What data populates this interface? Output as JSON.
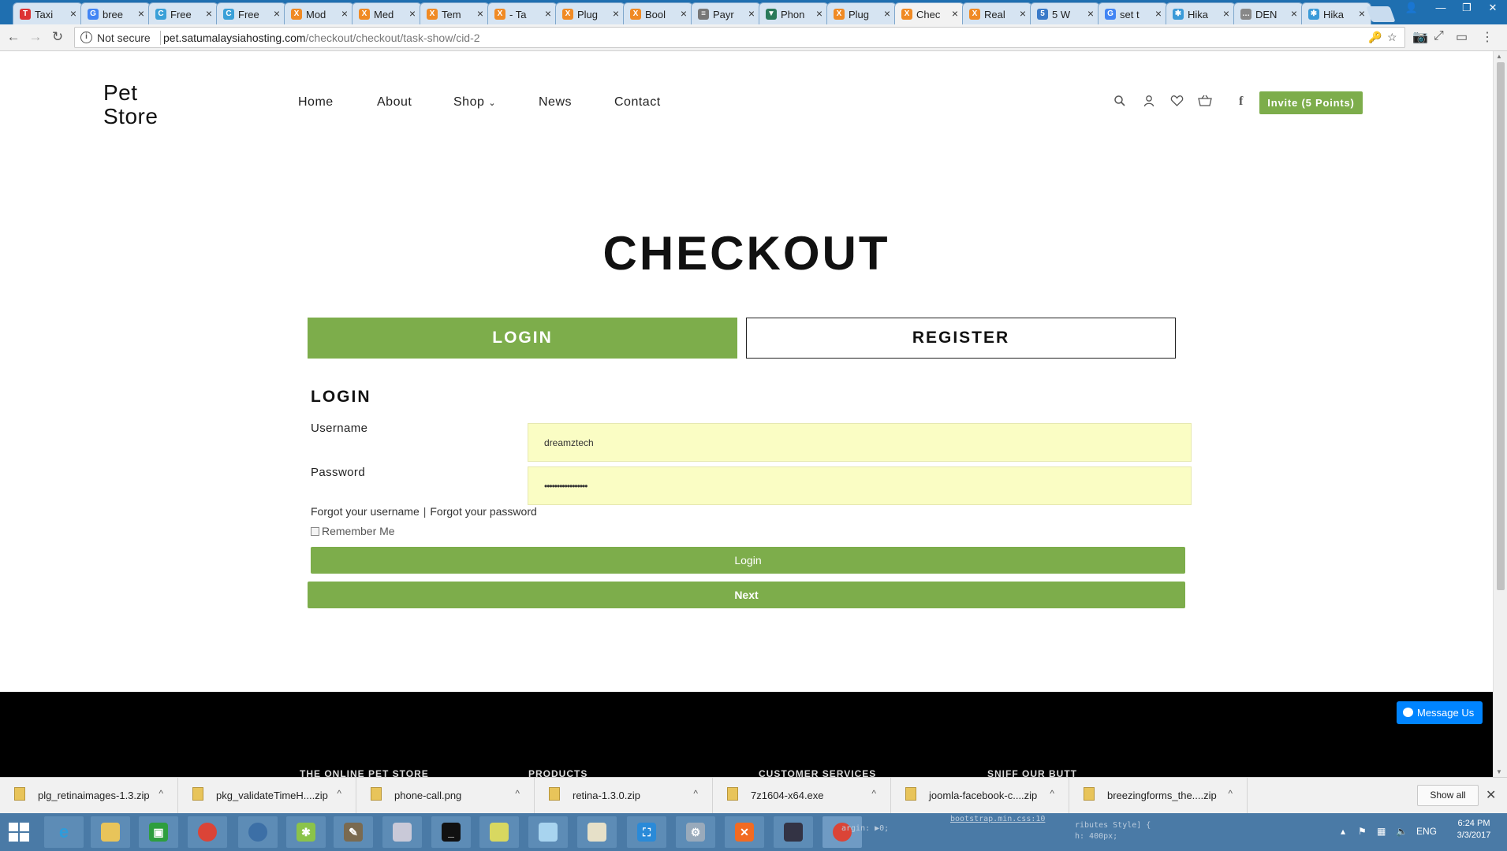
{
  "browser": {
    "tabs": [
      {
        "label": "Taxi",
        "fav": "T",
        "color": "#d33"
      },
      {
        "label": "bree",
        "fav": "G",
        "color": "#4285f4"
      },
      {
        "label": "Free",
        "fav": "C",
        "color": "#3aa0d8"
      },
      {
        "label": "Free",
        "fav": "C",
        "color": "#3aa0d8"
      },
      {
        "label": "Mod",
        "fav": "X",
        "color": "#f08a24"
      },
      {
        "label": "Med",
        "fav": "X",
        "color": "#f08a24"
      },
      {
        "label": "Tem",
        "fav": "X",
        "color": "#f08a24"
      },
      {
        "label": "- Ta",
        "fav": "X",
        "color": "#f08a24"
      },
      {
        "label": "Plug",
        "fav": "X",
        "color": "#f08a24"
      },
      {
        "label": "Bool",
        "fav": "X",
        "color": "#f08a24"
      },
      {
        "label": "Payr",
        "fav": "≡",
        "color": "#777"
      },
      {
        "label": "Phon",
        "fav": "▼",
        "color": "#2a7a5a"
      },
      {
        "label": "Plug",
        "fav": "X",
        "color": "#f08a24"
      },
      {
        "label": "Chec",
        "fav": "X",
        "color": "#f08a24"
      },
      {
        "label": "Real",
        "fav": "X",
        "color": "#f08a24"
      },
      {
        "label": "5 W",
        "fav": "5",
        "color": "#3a7ac8"
      },
      {
        "label": "set t",
        "fav": "G",
        "color": "#4285f4"
      },
      {
        "label": "Hika",
        "fav": "✱",
        "color": "#3a9ad8"
      },
      {
        "label": "DEN",
        "fav": "…",
        "color": "#888"
      },
      {
        "label": "Hika",
        "fav": "✱",
        "color": "#3a9ad8"
      }
    ],
    "active_tab_index": 13,
    "address": {
      "security": "Not secure",
      "host": "pet.satumalaysiahosting.com",
      "path": "/checkout/checkout/task-show/cid-2"
    }
  },
  "site": {
    "logo_line1": "Pet",
    "logo_line2": "Store",
    "nav": [
      "Home",
      "About",
      "Shop",
      "News",
      "Contact"
    ],
    "invite_label": "Invite (5 Points)",
    "accent": "#7dad4b"
  },
  "checkout": {
    "title": "CHECKOUT",
    "tab_login": "LOGIN",
    "tab_register": "REGISTER",
    "section_heading": "LOGIN",
    "username_label": "Username",
    "username_value": "dreamztech",
    "password_label": "Password",
    "password_value": "•••••••••••••••••",
    "forgot_username": "Forgot your username",
    "forgot_password": "Forgot your password",
    "remember_me": "Remember Me",
    "login_button": "Login",
    "next_button": "Next"
  },
  "footer": {
    "headings": [
      "THE ONLINE PET STORE",
      "PRODUCTS",
      "CUSTOMER SERVICES",
      "SNIFF OUR BUTT"
    ],
    "messenger": "Message Us"
  },
  "downloads": {
    "items": [
      "plg_retinaimages-1.3.zip",
      "pkg_validateTimeH....zip",
      "phone-call.png",
      "retina-1.3.0.zip",
      "7z1604-x64.exe",
      "joomla-facebook-c....zip",
      "breezingforms_the....zip"
    ],
    "show_all": "Show all"
  },
  "taskbar": {
    "code_fragments": [
      "argin: ▶0;",
      "bootstrap.min.css:10",
      "ributes Style] {",
      "h: 400px;"
    ],
    "language": "ENG",
    "time": "6:24 PM",
    "date": "3/3/2017"
  }
}
